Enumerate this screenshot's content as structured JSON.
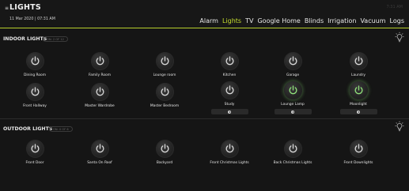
{
  "header": {
    "menu_icon": "≡",
    "title": "LIGHTS",
    "datetime": "11 Mar 2020 | 07:31 AM",
    "clock": "7:31 AM",
    "nav": [
      "Alarm",
      "Lights",
      "TV",
      "Google Home",
      "Blinds",
      "Irrigation",
      "Vacuum",
      "Logs"
    ],
    "active_nav": "Lights"
  },
  "indoor": {
    "title": "INDOOR LIGHTS",
    "count": "ON: 2 OF 12",
    "row1": [
      {
        "label": "Dining Room",
        "on": false
      },
      {
        "label": "Family Room",
        "on": false
      },
      {
        "label": "Lounge room",
        "on": false
      },
      {
        "label": "Kitchen",
        "on": false
      },
      {
        "label": "Garage",
        "on": false
      },
      {
        "label": "Laundry",
        "on": false
      }
    ],
    "row2": [
      {
        "label": "Front Hallway",
        "on": false
      },
      {
        "label": "Master Wardrobe",
        "on": false
      },
      {
        "label": "Master Bedroom",
        "on": false
      },
      {
        "label": "Study",
        "on": false,
        "dimmer": true
      },
      {
        "label": "Lounge Lamp",
        "on": true,
        "dimmer": true
      },
      {
        "label": "Moonlight",
        "on": true,
        "dimmer": true
      }
    ]
  },
  "outdoor": {
    "title": "OUTDOOR LIGHTS",
    "count": "ON: 0 OF 6",
    "row1": [
      {
        "label": "Front Door",
        "on": false
      },
      {
        "label": "Santa On Roof",
        "on": false
      },
      {
        "label": "Backyard",
        "on": false
      },
      {
        "label": "Front Christmas Lights",
        "on": false
      },
      {
        "label": "Back Christmas Lights",
        "on": false
      },
      {
        "label": "Front Downlights",
        "on": false
      }
    ]
  },
  "colors": {
    "accent": "#c6de2f",
    "on_icon": "#8fe07a",
    "off_icon": "#d8d8d8"
  }
}
